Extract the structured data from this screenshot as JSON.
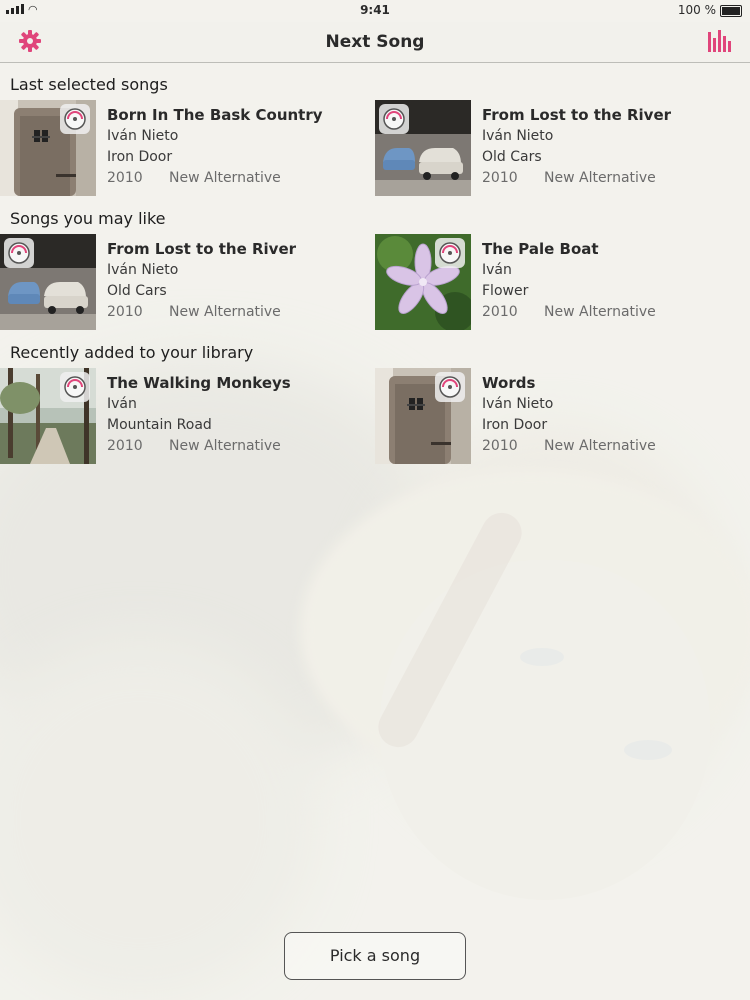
{
  "status_bar": {
    "time": "9:41",
    "battery": "100 %"
  },
  "nav": {
    "title": "Next Song",
    "left_icon": "gear-icon",
    "right_icon": "equalizer-icon",
    "accent": "#e0457b"
  },
  "sections": [
    {
      "title": "Last selected songs",
      "songs": [
        {
          "title": "Born In The Bask Country",
          "artist": "Iván Nieto",
          "album": "Iron Door",
          "year": "2010",
          "genre": "New Alternative",
          "art": "door"
        },
        {
          "title": "From Lost to the River",
          "artist": "Iván Nieto",
          "album": "Old Cars",
          "year": "2010",
          "genre": "New Alternative",
          "art": "cars"
        }
      ]
    },
    {
      "title": "Songs you may like",
      "songs": [
        {
          "title": "From Lost to the River",
          "artist": "Iván Nieto",
          "album": "Old Cars",
          "year": "2010",
          "genre": "New Alternative",
          "art": "cars"
        },
        {
          "title": "The Pale Boat",
          "artist": "Iván",
          "album": "Flower",
          "year": "2010",
          "genre": "New Alternative",
          "art": "flower"
        }
      ]
    },
    {
      "title": "Recently added to your library",
      "songs": [
        {
          "title": "The Walking Monkeys",
          "artist": "Iván",
          "album": "Mountain Road",
          "year": "2010",
          "genre": "New Alternative",
          "art": "road"
        },
        {
          "title": "Words",
          "artist": "Iván Nieto",
          "album": "Iron Door",
          "year": "2010",
          "genre": "New Alternative",
          "art": "door"
        }
      ]
    }
  ],
  "pick_button": {
    "label": "Pick a song"
  }
}
